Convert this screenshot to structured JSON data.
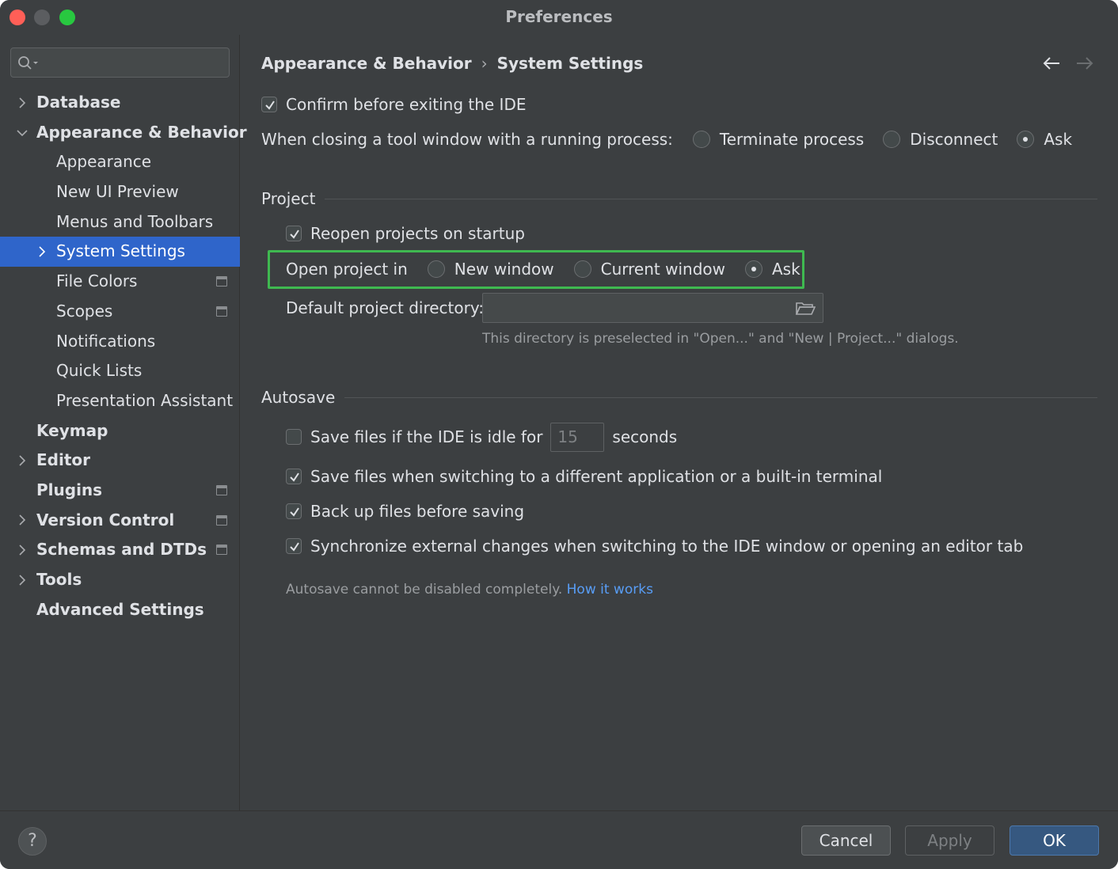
{
  "window": {
    "title": "Preferences"
  },
  "search": {
    "placeholder": ""
  },
  "sidebar": {
    "items": [
      {
        "label": "Database",
        "expanded": false
      },
      {
        "label": "Appearance & Behavior",
        "expanded": true
      },
      {
        "label": "Appearance"
      },
      {
        "label": "New UI Preview"
      },
      {
        "label": "Menus and Toolbars"
      },
      {
        "label": "System Settings",
        "selected": true
      },
      {
        "label": "File Colors"
      },
      {
        "label": "Scopes"
      },
      {
        "label": "Notifications"
      },
      {
        "label": "Quick Lists"
      },
      {
        "label": "Presentation Assistant"
      },
      {
        "label": "Keymap"
      },
      {
        "label": "Editor"
      },
      {
        "label": "Plugins"
      },
      {
        "label": "Version Control"
      },
      {
        "label": "Schemas and DTDs"
      },
      {
        "label": "Tools"
      },
      {
        "label": "Advanced Settings"
      }
    ]
  },
  "breadcrumb": {
    "parent": "Appearance & Behavior",
    "separator": "›",
    "current": "System Settings"
  },
  "general": {
    "confirm_exit": {
      "label": "Confirm before exiting the IDE",
      "checked": true
    },
    "closing_tool_window": {
      "label": "When closing a tool window with a running process:",
      "options": [
        "Terminate process",
        "Disconnect",
        "Ask"
      ],
      "selected": "Ask"
    }
  },
  "project": {
    "section_title": "Project",
    "reopen": {
      "label": "Reopen projects on startup",
      "checked": true
    },
    "open_in": {
      "label": "Open project in",
      "options": [
        "New window",
        "Current window",
        "Ask"
      ],
      "selected": "Ask"
    },
    "default_dir": {
      "label": "Default project directory:",
      "value": ""
    },
    "hint": "This directory is preselected in \"Open...\" and \"New | Project...\" dialogs."
  },
  "autosave": {
    "section_title": "Autosave",
    "idle": {
      "label": "Save files if the IDE is idle for",
      "value": "15",
      "unit": "seconds",
      "checked": false
    },
    "switching": {
      "label": "Save files when switching to a different application or a built-in terminal",
      "checked": true
    },
    "backup": {
      "label": "Back up files before saving",
      "checked": true
    },
    "sync": {
      "label": "Synchronize external changes when switching to the IDE window or opening an editor tab",
      "checked": true
    },
    "note": "Autosave cannot be disabled completely.",
    "link": "How it works"
  },
  "footer": {
    "help": "?",
    "cancel": "Cancel",
    "apply": "Apply",
    "ok": "OK"
  },
  "colors": {
    "accent": "#2f65ca",
    "highlight_box": "#3fb950",
    "link": "#589df6"
  }
}
